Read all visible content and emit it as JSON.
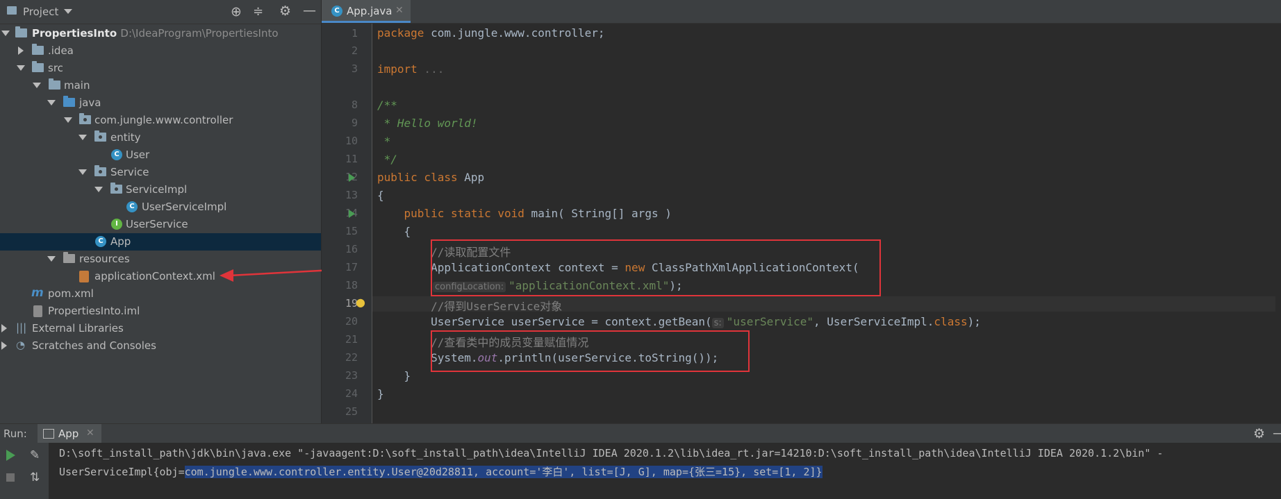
{
  "project_panel": {
    "title": "Project",
    "tree": [
      {
        "label": "PropertiesInto",
        "path": "D:\\IdeaProgram\\PropertiesInto"
      },
      {
        "label": ".idea"
      },
      {
        "label": "src"
      },
      {
        "label": "main"
      },
      {
        "label": "java"
      },
      {
        "label": "com.jungle.www.controller"
      },
      {
        "label": "entity"
      },
      {
        "label": "User"
      },
      {
        "label": "Service"
      },
      {
        "label": "ServiceImpl"
      },
      {
        "label": "UserServiceImpl"
      },
      {
        "label": "UserService"
      },
      {
        "label": "App"
      },
      {
        "label": "resources"
      },
      {
        "label": "applicationContext.xml"
      },
      {
        "label": "pom.xml"
      },
      {
        "label": "PropertiesInto.iml"
      },
      {
        "label": "External Libraries"
      },
      {
        "label": "Scratches and Consoles"
      }
    ]
  },
  "editor": {
    "tab_label": "App.java",
    "line_numbers": [
      "1",
      "2",
      "3",
      "8",
      "9",
      "10",
      "11",
      "12",
      "13",
      "14",
      "15",
      "16",
      "17",
      "18",
      "19",
      "20",
      "21",
      "22",
      "23",
      "24",
      "25"
    ],
    "lines": {
      "l1_kw": "package",
      "l1_rest": " com.jungle.www.controller;",
      "l3_kw": "import",
      "l3_fold": " ...",
      "l8": "/**",
      "l9": " * Hello world!",
      "l10": " *",
      "l11": " */",
      "l12_kw": "public class",
      "l12_rest": " App",
      "l13": "{",
      "l14_kw": "    public static void",
      "l14_rest": " main( String[] args )",
      "l15": "    {",
      "l16": "        //读取配置文件",
      "l17_a": "        ApplicationContext context = ",
      "l17_kw": "new",
      "l17_b": " ClassPathXmlApplicationContext(",
      "l18_hint": "configLocation:",
      "l18_str": "\"applicationContext.xml\"",
      "l18_end": ");",
      "l19": "        //得到UserService对象",
      "l20_a": "        UserService userService = context.getBean(",
      "l20_hint": "s:",
      "l20_str": "\"userService\"",
      "l20_b": ", UserServiceImpl.",
      "l20_kw": "class",
      "l20_end": ");",
      "l21": "        //查看类中的成员变量赋值情况",
      "l22_a": "        System.",
      "l22_fld": "out",
      "l22_b": ".println(userService.toString());",
      "l23": "    }",
      "l24": "}"
    }
  },
  "run_panel": {
    "label": "Run:",
    "tab_label": "App",
    "line1": "D:\\soft_install_path\\jdk\\bin\\java.exe \"-javaagent:D:\\soft_install_path\\idea\\IntelliJ IDEA 2020.1.2\\lib\\idea_rt.jar=14210:D:\\soft_install_path\\idea\\IntelliJ IDEA 2020.1.2\\bin\" -",
    "line2_prefix": "UserServiceImpl{obj=",
    "line2_selected": "com.jungle.www.controller.entity.User@20d28811, account='李白', list=[J, G], map={张三=15}, set=[1, 2]}"
  },
  "colors": {
    "annotation_red": "#e0343a",
    "selection_blue": "#214283",
    "tree_selected": "#0d293e"
  }
}
